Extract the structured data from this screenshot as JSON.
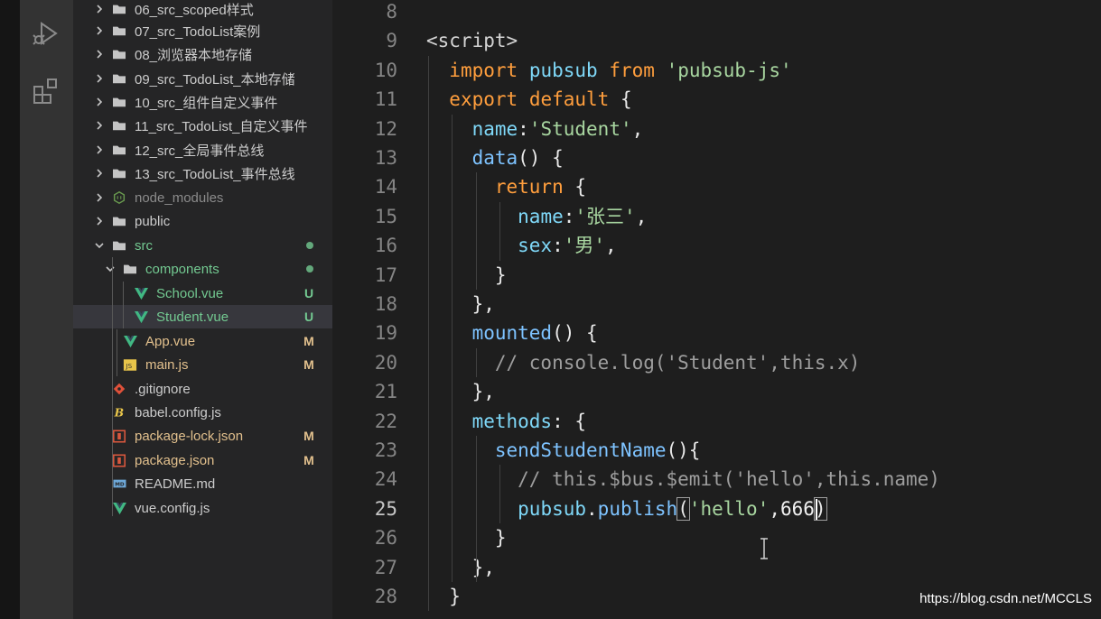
{
  "explorer": {
    "items": [
      {
        "name": "06_src_scoped样式",
        "kind": "folder",
        "state": "collapsed"
      },
      {
        "name": "07_src_TodoList案例",
        "kind": "folder",
        "state": "collapsed"
      },
      {
        "name": "08_浏览器本地存储",
        "kind": "folder",
        "state": "collapsed"
      },
      {
        "name": "09_src_TodoList_本地存储",
        "kind": "folder",
        "state": "collapsed"
      },
      {
        "name": "10_src_组件自定义事件",
        "kind": "folder",
        "state": "collapsed"
      },
      {
        "name": "11_src_TodoList_自定义事件",
        "kind": "folder",
        "state": "collapsed"
      },
      {
        "name": "12_src_全局事件总线",
        "kind": "folder",
        "state": "collapsed"
      },
      {
        "name": "13_src_TodoList_事件总线",
        "kind": "folder",
        "state": "collapsed"
      },
      {
        "name": "node_modules",
        "kind": "node-folder",
        "state": "collapsed"
      },
      {
        "name": "public",
        "kind": "folder",
        "state": "collapsed"
      },
      {
        "name": "src",
        "kind": "folder",
        "state": "expanded"
      },
      {
        "name": "components",
        "kind": "folder",
        "state": "expanded"
      },
      {
        "name": "School.vue",
        "kind": "vue",
        "badge": "U"
      },
      {
        "name": "Student.vue",
        "kind": "vue",
        "badge": "U"
      },
      {
        "name": "App.vue",
        "kind": "vue",
        "badge": "M"
      },
      {
        "name": "main.js",
        "kind": "js",
        "badge": "M"
      },
      {
        "name": ".gitignore",
        "kind": "git"
      },
      {
        "name": "babel.config.js",
        "kind": "babel"
      },
      {
        "name": "package-lock.json",
        "kind": "json",
        "badge": "M"
      },
      {
        "name": "package.json",
        "kind": "json",
        "badge": "M"
      },
      {
        "name": "README.md",
        "kind": "md"
      },
      {
        "name": "vue.config.js",
        "kind": "vue"
      }
    ]
  },
  "editor": {
    "active_line": "25",
    "lines": [
      {
        "num": "8",
        "tokens": []
      },
      {
        "num": "9",
        "tokens": [
          {
            "t": "<script>",
            "c": "tag"
          }
        ]
      },
      {
        "num": "10",
        "tokens": [
          {
            "t": "  ",
            "c": "plain"
          },
          {
            "t": "import",
            "c": "key"
          },
          {
            "t": " ",
            "c": "plain"
          },
          {
            "t": "pubsub",
            "c": "id"
          },
          {
            "t": " ",
            "c": "plain"
          },
          {
            "t": "from",
            "c": "key"
          },
          {
            "t": " ",
            "c": "plain"
          },
          {
            "t": "'pubsub-js'",
            "c": "str"
          }
        ]
      },
      {
        "num": "11",
        "tokens": [
          {
            "t": "  ",
            "c": "plain"
          },
          {
            "t": "export",
            "c": "key"
          },
          {
            "t": " ",
            "c": "plain"
          },
          {
            "t": "default",
            "c": "key"
          },
          {
            "t": " {",
            "c": "plain"
          }
        ]
      },
      {
        "num": "12",
        "tokens": [
          {
            "t": "    ",
            "c": "plain"
          },
          {
            "t": "name",
            "c": "id"
          },
          {
            "t": ":",
            "c": "plain"
          },
          {
            "t": "'Student'",
            "c": "str"
          },
          {
            "t": ",",
            "c": "plain"
          }
        ]
      },
      {
        "num": "13",
        "tokens": [
          {
            "t": "    ",
            "c": "plain"
          },
          {
            "t": "data",
            "c": "fn"
          },
          {
            "t": "() {",
            "c": "plain"
          }
        ]
      },
      {
        "num": "14",
        "tokens": [
          {
            "t": "      ",
            "c": "plain"
          },
          {
            "t": "return",
            "c": "key"
          },
          {
            "t": " {",
            "c": "plain"
          }
        ]
      },
      {
        "num": "15",
        "tokens": [
          {
            "t": "        ",
            "c": "plain"
          },
          {
            "t": "name",
            "c": "id"
          },
          {
            "t": ":",
            "c": "plain"
          },
          {
            "t": "'张三'",
            "c": "str"
          },
          {
            "t": ",",
            "c": "plain"
          }
        ]
      },
      {
        "num": "16",
        "tokens": [
          {
            "t": "        ",
            "c": "plain"
          },
          {
            "t": "sex",
            "c": "id"
          },
          {
            "t": ":",
            "c": "plain"
          },
          {
            "t": "'男'",
            "c": "str"
          },
          {
            "t": ",",
            "c": "plain"
          }
        ]
      },
      {
        "num": "17",
        "tokens": [
          {
            "t": "      }",
            "c": "plain"
          }
        ]
      },
      {
        "num": "18",
        "tokens": [
          {
            "t": "    },",
            "c": "plain"
          }
        ]
      },
      {
        "num": "19",
        "tokens": [
          {
            "t": "    ",
            "c": "plain"
          },
          {
            "t": "mounted",
            "c": "fn"
          },
          {
            "t": "() {",
            "c": "plain"
          }
        ]
      },
      {
        "num": "20",
        "tokens": [
          {
            "t": "      ",
            "c": "plain"
          },
          {
            "t": "// console.log('Student',this.x)",
            "c": "cmt"
          }
        ]
      },
      {
        "num": "21",
        "tokens": [
          {
            "t": "    },",
            "c": "plain"
          }
        ]
      },
      {
        "num": "22",
        "tokens": [
          {
            "t": "    ",
            "c": "plain"
          },
          {
            "t": "methods",
            "c": "id"
          },
          {
            "t": ": {",
            "c": "plain"
          }
        ]
      },
      {
        "num": "23",
        "tokens": [
          {
            "t": "      ",
            "c": "plain"
          },
          {
            "t": "sendStudentName",
            "c": "fn"
          },
          {
            "t": "(){",
            "c": "plain"
          }
        ]
      },
      {
        "num": "24",
        "tokens": [
          {
            "t": "        ",
            "c": "plain"
          },
          {
            "t": "// this.$bus.$emit('hello',this.name)",
            "c": "cmt"
          }
        ]
      },
      {
        "num": "25",
        "tokens": [
          {
            "t": "        ",
            "c": "plain"
          },
          {
            "t": "pubsub",
            "c": "id"
          },
          {
            "t": ".",
            "c": "plain"
          },
          {
            "t": "publish",
            "c": "fn"
          },
          {
            "t": "(",
            "c": "plain",
            "box": true
          },
          {
            "t": "'hello'",
            "c": "str"
          },
          {
            "t": ",",
            "c": "plain"
          },
          {
            "t": "666",
            "c": "num"
          },
          {
            "t": ")",
            "c": "plain",
            "box": true,
            "cursor_before": true
          }
        ]
      },
      {
        "num": "26",
        "tokens": [
          {
            "t": "      }",
            "c": "plain"
          }
        ]
      },
      {
        "num": "27",
        "tokens": [
          {
            "t": "    },",
            "c": "plain"
          }
        ]
      },
      {
        "num": "28",
        "tokens": [
          {
            "t": "  }",
            "c": "plain"
          }
        ]
      }
    ]
  },
  "watermark": "https://blog.csdn.net/MCCLS",
  "colors": {
    "badge_untracked": "#73c991",
    "badge_modified": "#e2c08d",
    "keyword": "#ff9e3d",
    "string": "#a8d6a0",
    "function": "#7ec3ff"
  }
}
